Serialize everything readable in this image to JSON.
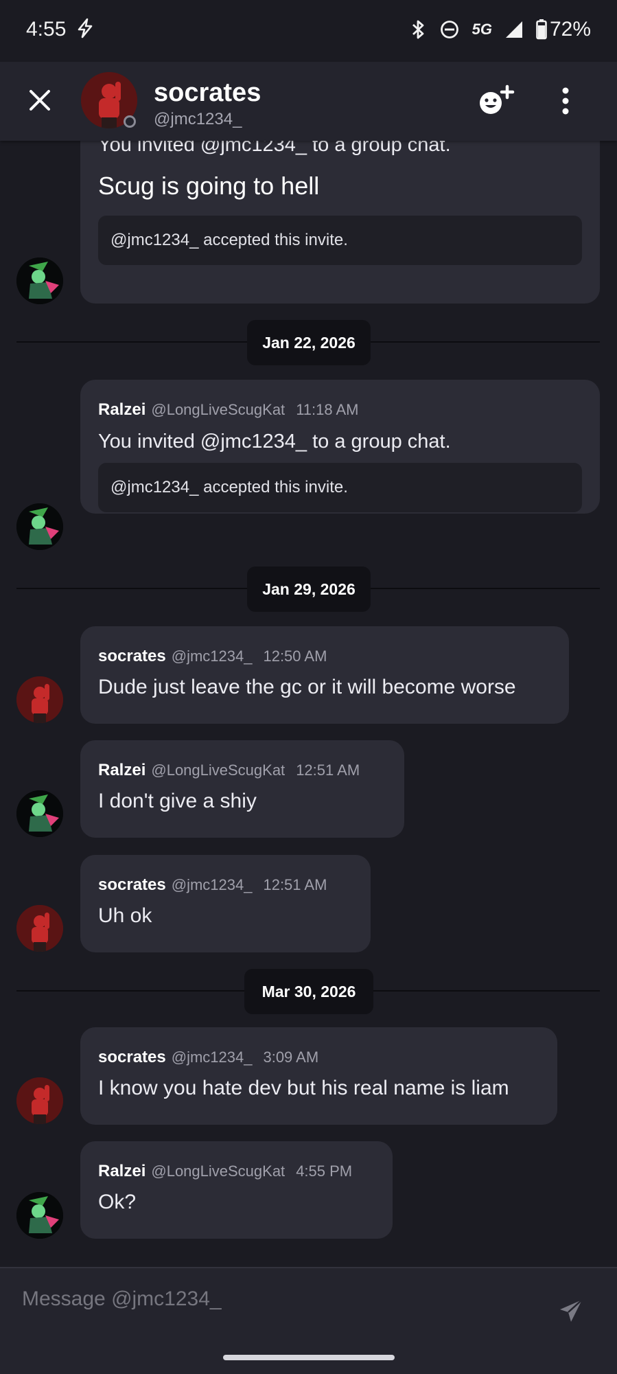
{
  "status_bar": {
    "time": "4:55",
    "network": "5G",
    "battery": "72%"
  },
  "header": {
    "name": "socrates",
    "handle": "@jmc1234_"
  },
  "messages": [
    {
      "invite_text": "You invited @jmc1234_ to a group chat.",
      "group_name": "Scug is going to hell",
      "accepted_text": "@jmc1234_ accepted this invite."
    },
    {
      "date": "Jan 22, 2026"
    },
    {
      "author": "Ralzei",
      "handle": "@LongLiveScugKat",
      "time": "11:18 AM",
      "invite_text": "You invited @jmc1234_ to a group chat.",
      "accepted_text": "@jmc1234_ accepted this invite."
    },
    {
      "date": "Jan 29, 2026"
    },
    {
      "author": "socrates",
      "handle": "@jmc1234_",
      "time": "12:50 AM",
      "text": "Dude just leave the gc or it will become worse"
    },
    {
      "author": "Ralzei",
      "handle": "@LongLiveScugKat",
      "time": "12:51 AM",
      "text": "I don't give a shiy"
    },
    {
      "author": "socrates",
      "handle": "@jmc1234_",
      "time": "12:51 AM",
      "text": "Uh ok"
    },
    {
      "date": "Mar 30, 2026"
    },
    {
      "author": "socrates",
      "handle": "@jmc1234_",
      "time": "3:09 AM",
      "text": "I know you hate dev but his real name is liam"
    },
    {
      "author": "Ralzei",
      "handle": "@LongLiveScugKat",
      "time": "4:55 PM",
      "text": "Ok?"
    }
  ],
  "composer": {
    "placeholder": "Message @jmc1234_"
  },
  "colors": {
    "background": "#1b1b22",
    "card": "#2c2c36",
    "header": "#24242d"
  }
}
